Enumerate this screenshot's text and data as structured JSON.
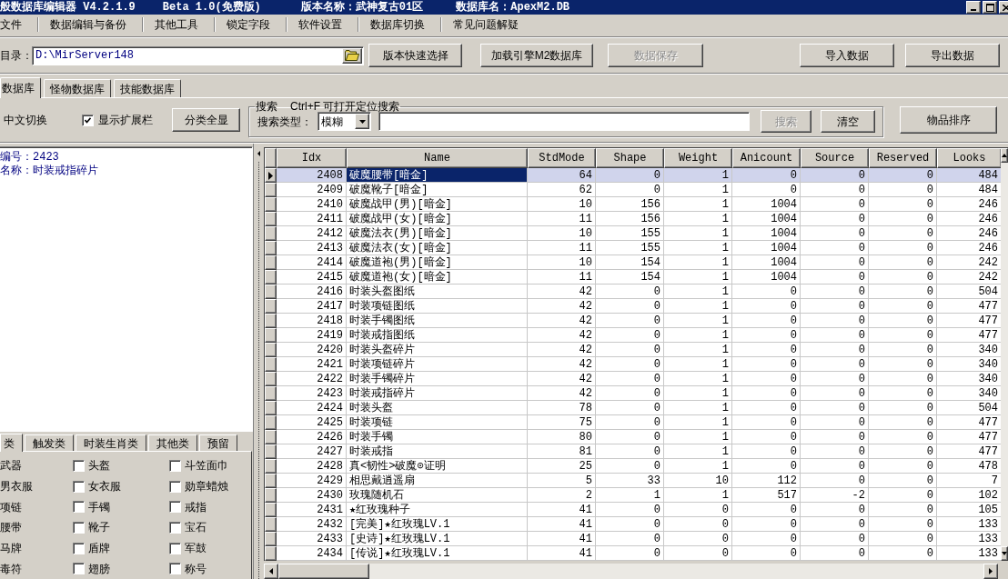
{
  "window": {
    "title_parts": [
      "般数据库编辑器 V4.2.1.9",
      "Beta 1.0(免费版)",
      "版本名称：武神复古01区",
      "数据库名：ApexM2.DB"
    ]
  },
  "menu": [
    "文件",
    "数据编辑与备份",
    "其他工具",
    "锁定字段",
    "软件设置",
    "数据库切换",
    "常见问题解疑"
  ],
  "toolbar": {
    "directory_label": "目录：",
    "directory_value": "D:\\MirServer148",
    "buttons": [
      {
        "label": "版本快速选择",
        "disabled": false
      },
      {
        "label": "加载引擎M2数据库",
        "disabled": false
      },
      {
        "label": "数据保存",
        "disabled": true
      }
    ],
    "right_buttons": [
      {
        "label": "导入数据",
        "disabled": false
      },
      {
        "label": "导出数据",
        "disabled": false
      }
    ]
  },
  "tabs": [
    {
      "label": "数据库",
      "selected": true
    },
    {
      "label": "怪物数据库",
      "selected": false
    },
    {
      "label": "技能数据库",
      "selected": false
    }
  ],
  "options": {
    "language_toggle": "中文切换",
    "show_extension": {
      "label": "显示扩展栏",
      "checked": true
    },
    "show_all_button": "分类全显"
  },
  "search": {
    "title": "搜索",
    "hint": "Ctrl+F 可打开定位搜索",
    "type_label": "搜索类型：",
    "type_value": "模糊",
    "buttons": [
      {
        "label": "搜索",
        "disabled": true
      },
      {
        "label": "清空",
        "disabled": false
      }
    ]
  },
  "sort_button": "物品排序",
  "item_info": [
    "编号：2423",
    "名称：时装戒指碎片"
  ],
  "category_tabs": [
    {
      "label": "类",
      "selected": true
    },
    {
      "label": "触发类",
      "selected": false
    },
    {
      "label": "时装生肖类",
      "selected": false
    },
    {
      "label": "其他类",
      "selected": false
    },
    {
      "label": "预留",
      "selected": false
    }
  ],
  "categories": {
    "column_1": [
      "武器",
      "男衣服",
      "项链",
      "腰带",
      "马牌",
      "毒符"
    ],
    "checkbox_columns": [
      [
        {
          "label": "头盔",
          "checked": false
        },
        {
          "label": "女衣服",
          "checked": false
        },
        {
          "label": "手镯",
          "checked": false
        },
        {
          "label": "靴子",
          "checked": false
        },
        {
          "label": "盾牌",
          "checked": false
        },
        {
          "label": "翅膀",
          "checked": false
        }
      ],
      [
        {
          "label": "斗笠面巾",
          "checked": false
        },
        {
          "label": "勋章蜡烛",
          "checked": false
        },
        {
          "label": "戒指",
          "checked": false
        },
        {
          "label": "宝石",
          "checked": false
        },
        {
          "label": "军鼓",
          "checked": false
        },
        {
          "label": "称号",
          "checked": false
        }
      ]
    ]
  },
  "table": {
    "columns": [
      "Idx",
      "Name",
      "StdMode",
      "Shape",
      "Weight",
      "Anicount",
      "Source",
      "Reserved",
      "Looks"
    ],
    "rows": [
      {
        "selected": true,
        "cells": [
          "2408",
          "破魔腰带[暗金]",
          "64",
          "0",
          "1",
          "0",
          "0",
          "0",
          "484"
        ]
      },
      {
        "selected": false,
        "cells": [
          "2409",
          "破魔靴子[暗金]",
          "62",
          "0",
          "1",
          "0",
          "0",
          "0",
          "484"
        ]
      },
      {
        "selected": false,
        "cells": [
          "2410",
          "破魔战甲(男)[暗金]",
          "10",
          "156",
          "1",
          "1004",
          "0",
          "0",
          "246"
        ]
      },
      {
        "selected": false,
        "cells": [
          "2411",
          "破魔战甲(女)[暗金]",
          "11",
          "156",
          "1",
          "1004",
          "0",
          "0",
          "246"
        ]
      },
      {
        "selected": false,
        "cells": [
          "2412",
          "破魔法衣(男)[暗金]",
          "10",
          "155",
          "1",
          "1004",
          "0",
          "0",
          "246"
        ]
      },
      {
        "selected": false,
        "cells": [
          "2413",
          "破魔法衣(女)[暗金]",
          "11",
          "155",
          "1",
          "1004",
          "0",
          "0",
          "246"
        ]
      },
      {
        "selected": false,
        "cells": [
          "2414",
          "破魔道袍(男)[暗金]",
          "10",
          "154",
          "1",
          "1004",
          "0",
          "0",
          "242"
        ]
      },
      {
        "selected": false,
        "cells": [
          "2415",
          "破魔道袍(女)[暗金]",
          "11",
          "154",
          "1",
          "1004",
          "0",
          "0",
          "242"
        ]
      },
      {
        "selected": false,
        "cells": [
          "2416",
          "时装头盔图纸",
          "42",
          "0",
          "1",
          "0",
          "0",
          "0",
          "504"
        ]
      },
      {
        "selected": false,
        "cells": [
          "2417",
          "时装项链图纸",
          "42",
          "0",
          "1",
          "0",
          "0",
          "0",
          "477"
        ]
      },
      {
        "selected": false,
        "cells": [
          "2418",
          "时装手镯图纸",
          "42",
          "0",
          "1",
          "0",
          "0",
          "0",
          "477"
        ]
      },
      {
        "selected": false,
        "cells": [
          "2419",
          "时装戒指图纸",
          "42",
          "0",
          "1",
          "0",
          "0",
          "0",
          "477"
        ]
      },
      {
        "selected": false,
        "cells": [
          "2420",
          "时装头盔碎片",
          "42",
          "0",
          "1",
          "0",
          "0",
          "0",
          "340"
        ]
      },
      {
        "selected": false,
        "cells": [
          "2421",
          "时装项链碎片",
          "42",
          "0",
          "1",
          "0",
          "0",
          "0",
          "340"
        ]
      },
      {
        "selected": false,
        "cells": [
          "2422",
          "时装手镯碎片",
          "42",
          "0",
          "1",
          "0",
          "0",
          "0",
          "340"
        ]
      },
      {
        "selected": false,
        "cells": [
          "2423",
          "时装戒指碎片",
          "42",
          "0",
          "1",
          "0",
          "0",
          "0",
          "340"
        ]
      },
      {
        "selected": false,
        "cells": [
          "2424",
          "时装头盔",
          "78",
          "0",
          "1",
          "0",
          "0",
          "0",
          "504"
        ]
      },
      {
        "selected": false,
        "cells": [
          "2425",
          "时装项链",
          "75",
          "0",
          "1",
          "0",
          "0",
          "0",
          "477"
        ]
      },
      {
        "selected": false,
        "cells": [
          "2426",
          "时装手镯",
          "80",
          "0",
          "1",
          "0",
          "0",
          "0",
          "477"
        ]
      },
      {
        "selected": false,
        "cells": [
          "2427",
          "时装戒指",
          "81",
          "0",
          "1",
          "0",
          "0",
          "0",
          "477"
        ]
      },
      {
        "selected": false,
        "cells": [
          "2428",
          "真<韧性>破魔⊙证明",
          "25",
          "0",
          "1",
          "0",
          "0",
          "0",
          "478"
        ]
      },
      {
        "selected": false,
        "cells": [
          "2429",
          "相思戴逍遥扇",
          "5",
          "33",
          "10",
          "112",
          "0",
          "0",
          "7"
        ]
      },
      {
        "selected": false,
        "cells": [
          "2430",
          "玫瑰随机石",
          "2",
          "1",
          "1",
          "517",
          "-2",
          "0",
          "102"
        ]
      },
      {
        "selected": false,
        "cells": [
          "2431",
          "★红玫瑰种子",
          "41",
          "0",
          "0",
          "0",
          "0",
          "0",
          "105"
        ]
      },
      {
        "selected": false,
        "cells": [
          "2432",
          "[完美]★红玫瑰LV.1",
          "41",
          "0",
          "0",
          "0",
          "0",
          "0",
          "133"
        ]
      },
      {
        "selected": false,
        "cells": [
          "2433",
          "[史诗]★红玫瑰LV.1",
          "41",
          "0",
          "0",
          "0",
          "0",
          "0",
          "133"
        ]
      },
      {
        "selected": false,
        "cells": [
          "2434",
          "[传说]★红玫瑰LV.1",
          "41",
          "0",
          "0",
          "0",
          "0",
          "0",
          "133"
        ]
      }
    ]
  }
}
